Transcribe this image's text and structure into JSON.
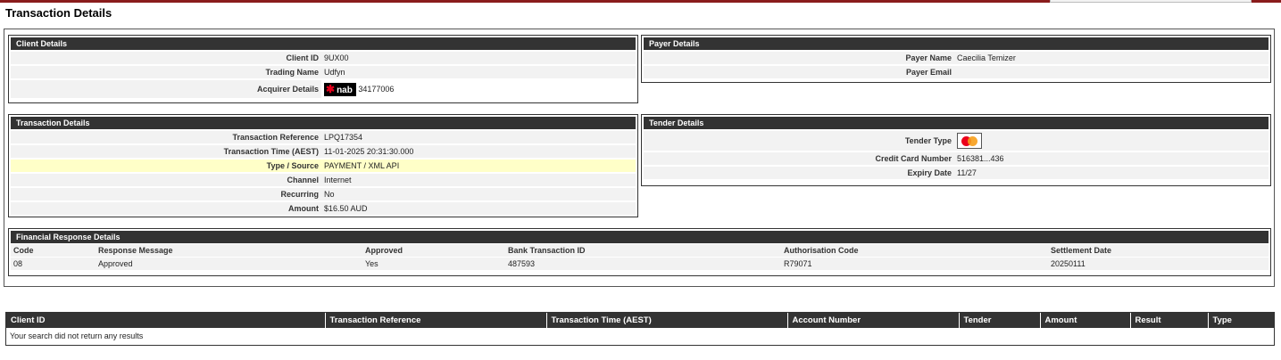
{
  "page": {
    "title": "Transaction Details"
  },
  "client_details": {
    "header": "Client Details",
    "rows": [
      {
        "label": "Client ID",
        "value": "9UX00"
      },
      {
        "label": "Trading Name",
        "value": "Udfyn"
      },
      {
        "label": "Acquirer Details",
        "logo": "nab",
        "value": "34177006"
      }
    ]
  },
  "payer_details": {
    "header": "Payer Details",
    "rows": [
      {
        "label": "Payer Name",
        "value": "Caecilia Temizer"
      },
      {
        "label": "Payer Email",
        "value": ""
      }
    ]
  },
  "transaction_details": {
    "header": "Transaction Details",
    "rows": [
      {
        "label": "Transaction Reference",
        "value": "LPQ17354"
      },
      {
        "label": "Transaction Time (AEST)",
        "value": "11-01-2025 20:31:30.000"
      },
      {
        "label": "Type / Source",
        "value": "PAYMENT / XML API"
      },
      {
        "label": "Channel",
        "value": "Internet"
      },
      {
        "label": "Recurring",
        "value": "No"
      },
      {
        "label": "Amount",
        "value": "$16.50 AUD"
      }
    ]
  },
  "tender_details": {
    "header": "Tender Details",
    "rows": [
      {
        "label": "Tender Type",
        "icon": "mastercard-icon"
      },
      {
        "label": "Credit Card Number",
        "value": "516381...436"
      },
      {
        "label": "Expiry Date",
        "value": "11/27"
      }
    ]
  },
  "financial_response": {
    "header": "Financial Response Details",
    "columns": [
      "Code",
      "Response Message",
      "Approved",
      "Bank Transaction ID",
      "Authorisation Code",
      "Settlement Date"
    ],
    "row": [
      "08",
      "Approved",
      "Yes",
      "487593",
      "R79071",
      "20250111"
    ]
  },
  "results": {
    "columns": [
      "Client ID",
      "Transaction Reference",
      "Transaction Time (AEST)",
      "Account Number",
      "Tender",
      "Amount",
      "Result",
      "Type"
    ],
    "empty_message": "Your search did not return any results"
  },
  "colors": {
    "header_bg": "#333333",
    "row_bg": "#f2f2f2",
    "highlight": "#ffffc8",
    "top_bar": "#8a1c1c"
  }
}
